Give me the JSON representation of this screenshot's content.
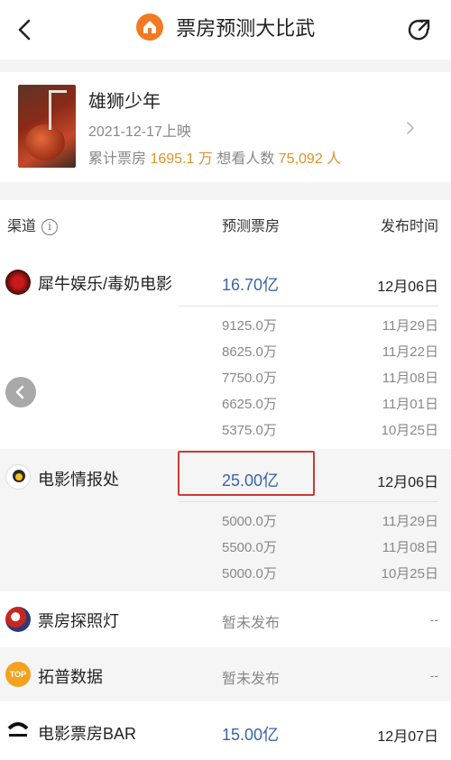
{
  "header": {
    "title": "票房预测大比武",
    "back_icon": "chevron-left-icon",
    "app_icon": "house-icon",
    "share_icon": "share-arrow-icon",
    "accent_color": "#f27a22"
  },
  "movie": {
    "name": "雄狮少年",
    "release": "2021-12-17上映",
    "box_office_label": "累计票房",
    "box_office_value": "1695.1 万",
    "want_label": "想看人数",
    "want_value": "75,092 人"
  },
  "columns": {
    "channel": "渠道",
    "prediction": "预测票房",
    "publish_time": "发布时间"
  },
  "channels": [
    {
      "name": "犀牛娱乐/毒奶电影",
      "prediction": "16.70亿",
      "date": "12月06日",
      "history": [
        {
          "prediction": "9125.0万",
          "date": "11月29日"
        },
        {
          "prediction": "8625.0万",
          "date": "11月22日"
        },
        {
          "prediction": "7750.0万",
          "date": "11月08日"
        },
        {
          "prediction": "6625.0万",
          "date": "11月01日"
        },
        {
          "prediction": "5375.0万",
          "date": "10月25日"
        }
      ]
    },
    {
      "name": "电影情报处",
      "prediction": "25.00亿",
      "date": "12月06日",
      "history": [
        {
          "prediction": "5000.0万",
          "date": "11月29日"
        },
        {
          "prediction": "5500.0万",
          "date": "11月08日"
        },
        {
          "prediction": "5000.0万",
          "date": "10月25日"
        }
      ]
    },
    {
      "name": "票房探照灯",
      "pending": "暂未发布",
      "date": "--"
    },
    {
      "name": "拓普数据",
      "pending": "暂未发布",
      "date": "--"
    },
    {
      "name": "电影票房BAR",
      "prediction": "15.00亿",
      "date": "12月07日"
    }
  ],
  "colors": {
    "prediction_blue": "#3a64a8",
    "highlight_red": "#cc3a36",
    "stat_orange": "#e0922a"
  }
}
